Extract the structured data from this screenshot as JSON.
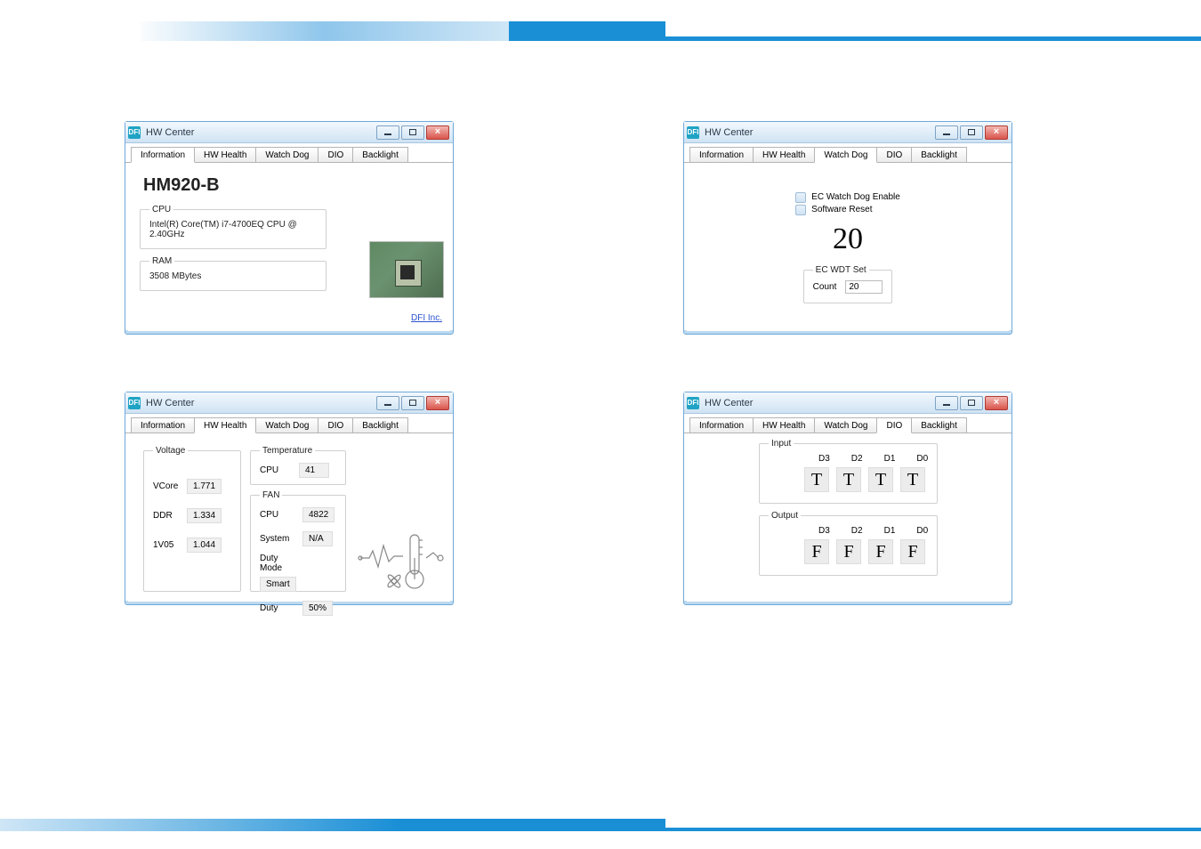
{
  "window_title": "HW Center",
  "title_icon_text": "DFI",
  "tabs": [
    "Information",
    "HW Health",
    "Watch Dog",
    "DIO",
    "Backlight"
  ],
  "link_text": "DFI Inc.",
  "information": {
    "model": "HM920-B",
    "cpu_legend": "CPU",
    "cpu_value": "Intel(R) Core(TM) i7-4700EQ CPU @ 2.40GHz",
    "ram_legend": "RAM",
    "ram_value": "3508 MBytes"
  },
  "hw_health": {
    "voltage_legend": "Voltage",
    "voltage_rows": [
      {
        "label": "VCore",
        "value": "1.771"
      },
      {
        "label": "DDR",
        "value": "1.334"
      },
      {
        "label": "1V05",
        "value": "1.044"
      }
    ],
    "temperature_legend": "Temperature",
    "temperature_rows": [
      {
        "label": "CPU",
        "value": "41"
      }
    ],
    "fan_legend": "FAN",
    "fan_rows": [
      {
        "label": "CPU",
        "value": "4822"
      },
      {
        "label": "System",
        "value": "N/A"
      },
      {
        "label": "Duty Mode",
        "value": "Smart"
      },
      {
        "label": "Duty",
        "value": "50%"
      }
    ]
  },
  "watch_dog": {
    "enable_label": "EC Watch Dog Enable",
    "reset_label": "Software Reset",
    "big_value": "20",
    "set_legend": "EC WDT Set",
    "count_label": "Count",
    "count_value": "20"
  },
  "dio": {
    "input_legend": "Input",
    "output_legend": "Output",
    "headers": [
      "D3",
      "D2",
      "D1",
      "D0"
    ],
    "input_values": [
      "T",
      "T",
      "T",
      "T"
    ],
    "output_values": [
      "F",
      "F",
      "F",
      "F"
    ]
  },
  "chart_data": [
    {
      "type": "table",
      "title": "Voltage",
      "categories": [
        "VCore",
        "DDR",
        "1V05"
      ],
      "values": [
        1.771,
        1.334,
        1.044
      ]
    },
    {
      "type": "table",
      "title": "Temperature",
      "categories": [
        "CPU"
      ],
      "values": [
        41
      ]
    },
    {
      "type": "table",
      "title": "FAN",
      "categories": [
        "CPU",
        "System",
        "Duty Mode",
        "Duty"
      ],
      "values": [
        4822,
        "N/A",
        "Smart",
        "50%"
      ]
    },
    {
      "type": "table",
      "title": "DIO Input",
      "categories": [
        "D3",
        "D2",
        "D1",
        "D0"
      ],
      "values": [
        "T",
        "T",
        "T",
        "T"
      ]
    },
    {
      "type": "table",
      "title": "DIO Output",
      "categories": [
        "D3",
        "D2",
        "D1",
        "D0"
      ],
      "values": [
        "F",
        "F",
        "F",
        "F"
      ]
    }
  ]
}
